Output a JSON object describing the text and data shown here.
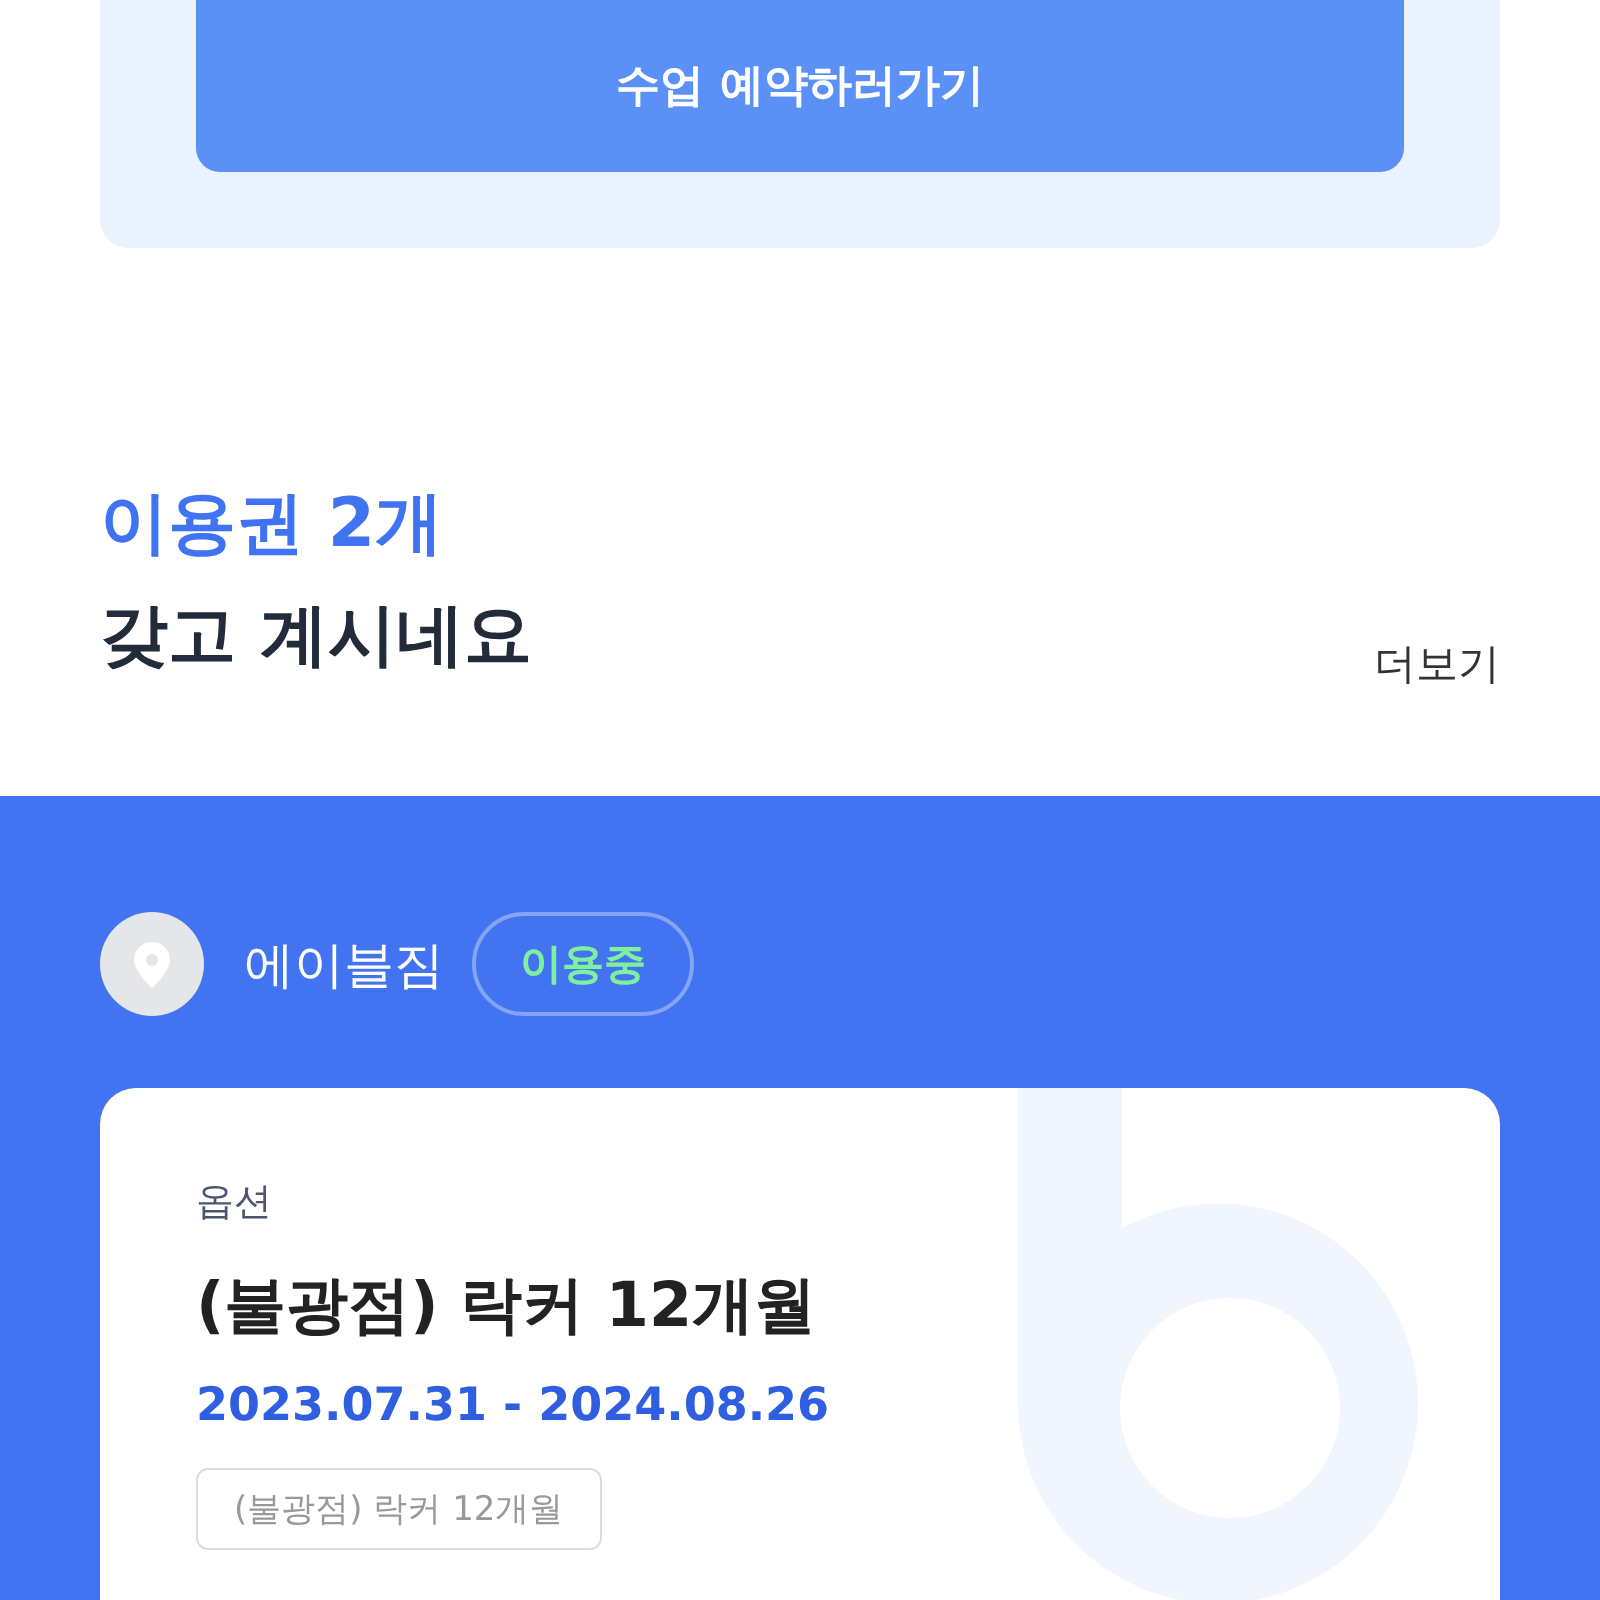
{
  "reserve_button": "수업 예약하러가기",
  "heading": {
    "highlight": "이용권 2개",
    "line2": "갖고 계시네요",
    "more_link": "더보기"
  },
  "branch": {
    "name": "에이블짐",
    "status": "이용중"
  },
  "pass_card": {
    "label": "옵션",
    "title": "(불광점) 락커 12개월",
    "period": "2023.07.31 - 2024.08.26",
    "tag": "(불광점) 락커 12개월"
  }
}
